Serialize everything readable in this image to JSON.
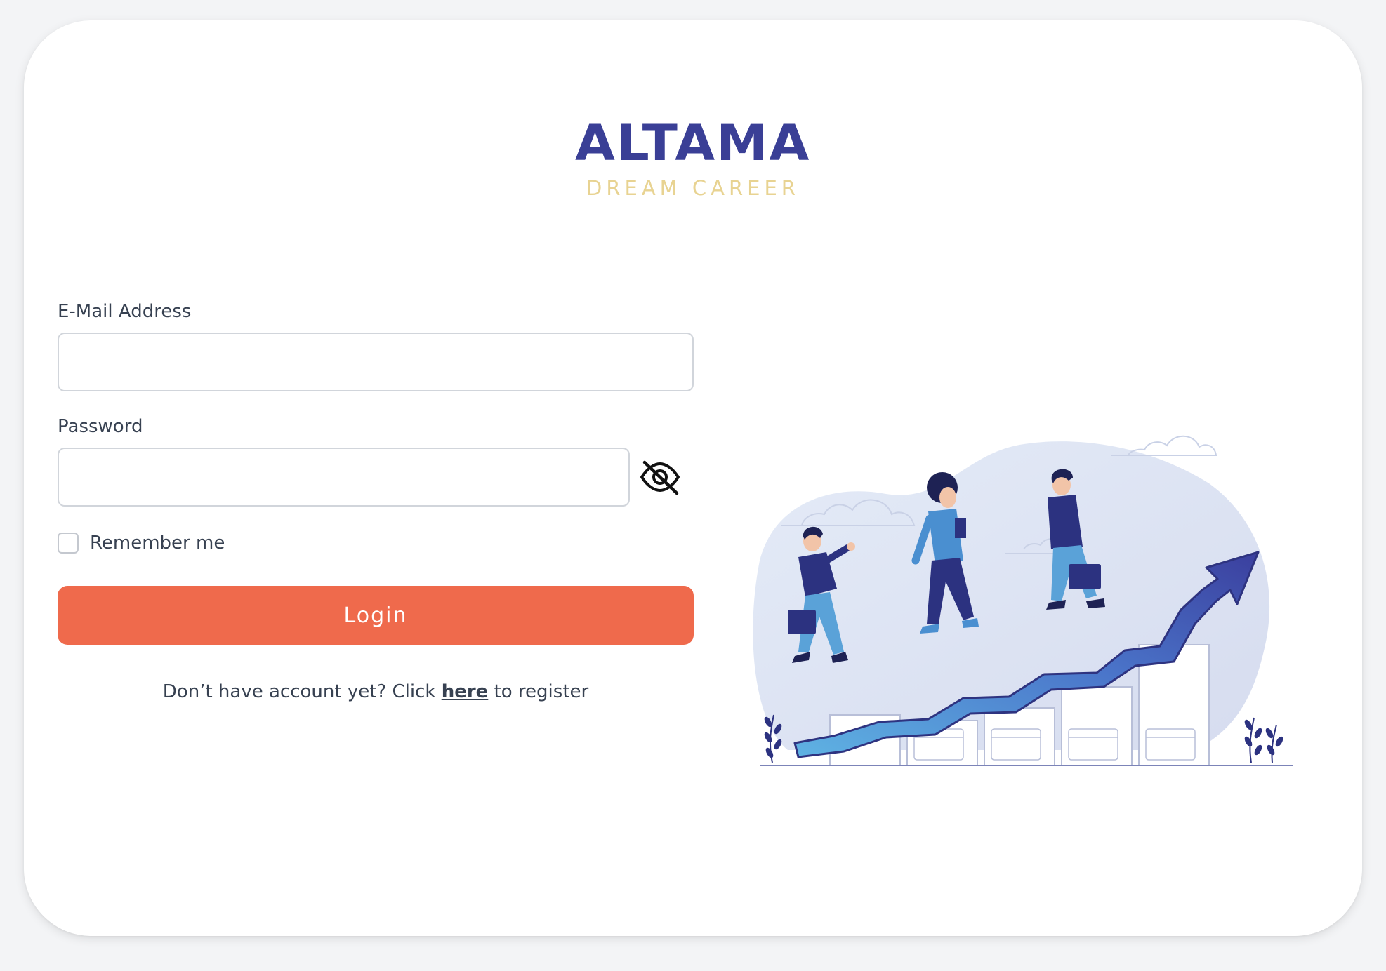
{
  "logo": {
    "title": "ALTAMA",
    "subtitle": "DREAM CAREER"
  },
  "form": {
    "email_label": "E-Mail Address",
    "email_value": "",
    "password_label": "Password",
    "password_value": "",
    "remember_label": "Remember me",
    "remember_checked": false,
    "login_label": "Login",
    "register_prefix": "Don’t have account yet? Click ",
    "register_link": "here",
    "register_suffix": " to register"
  },
  "icons": {
    "password_toggle": "eye-slash-icon"
  },
  "colors": {
    "brand": "#3a3f96",
    "brand_sub": "#e8d392",
    "login_button": "#ef6a4c",
    "background": "#f3f4f6"
  }
}
